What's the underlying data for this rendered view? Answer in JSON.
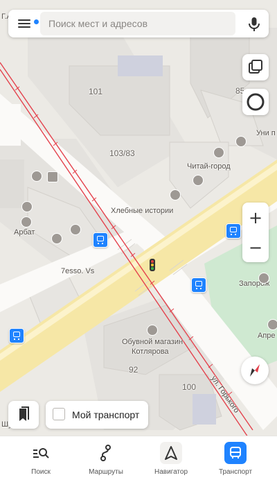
{
  "search": {
    "placeholder": "Поиск мест и адресов"
  },
  "map": {
    "labels": {
      "b101": "101",
      "b85": "85",
      "b103": "103/83",
      "uni": "Уни п",
      "chitai": "Читай-город",
      "hlebnye": "Хлебные истории",
      "arbat": "Арбат",
      "esso": "7esso. Vs",
      "zaporozh": "Запорож",
      "apre": "Апре",
      "shoes_line1": "Обувной магазин",
      "shoes_line2": "Котлярова",
      "b92": "92",
      "b100": "100",
      "street": "ул. Горького",
      "shu": "Шу",
      "corner": "Г.А"
    }
  },
  "bottom": {
    "my_transport": "Мой транспорт"
  },
  "tabs": [
    {
      "label": "Поиск",
      "icon": "search-list-icon"
    },
    {
      "label": "Маршруты",
      "icon": "route-icon"
    },
    {
      "label": "Навигатор",
      "icon": "navigator-arrow-icon"
    },
    {
      "label": "Транспорт",
      "icon": "bus-icon",
      "active": true
    }
  ],
  "colors": {
    "accent": "#1f83ff",
    "tram_line": "#e4424d",
    "main_road": "#f6e7a6"
  }
}
